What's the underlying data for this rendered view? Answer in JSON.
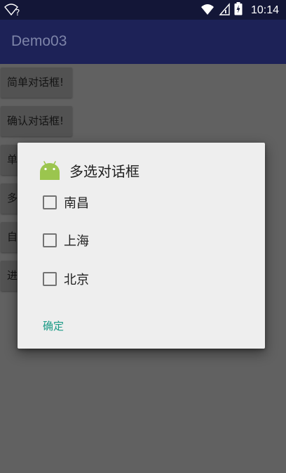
{
  "status_bar": {
    "time": "10:14",
    "icons": [
      "wifi-question-icon",
      "wifi-icon",
      "signal-icon",
      "battery-charging-icon"
    ],
    "wifi_question": "?"
  },
  "app_bar": {
    "title": "Demo03"
  },
  "background_buttons": [
    {
      "label": "简单对话框!"
    },
    {
      "label": "确认对话框!"
    },
    {
      "label": "单"
    },
    {
      "label": "多"
    },
    {
      "label": "自"
    },
    {
      "label": "进"
    }
  ],
  "dialog": {
    "title": "多选对话框",
    "icon": "android-icon",
    "options": [
      {
        "label": "南昌",
        "checked": false
      },
      {
        "label": "上海",
        "checked": false
      },
      {
        "label": "北京",
        "checked": false
      }
    ],
    "ok_label": "确定"
  },
  "colors": {
    "status_bar": "#131637",
    "app_bar": "#1d2257",
    "scrim_background": "#616161",
    "dialog_background": "#eeeeee",
    "accent": "#1a9a85",
    "android_green": "#9bc54e"
  }
}
